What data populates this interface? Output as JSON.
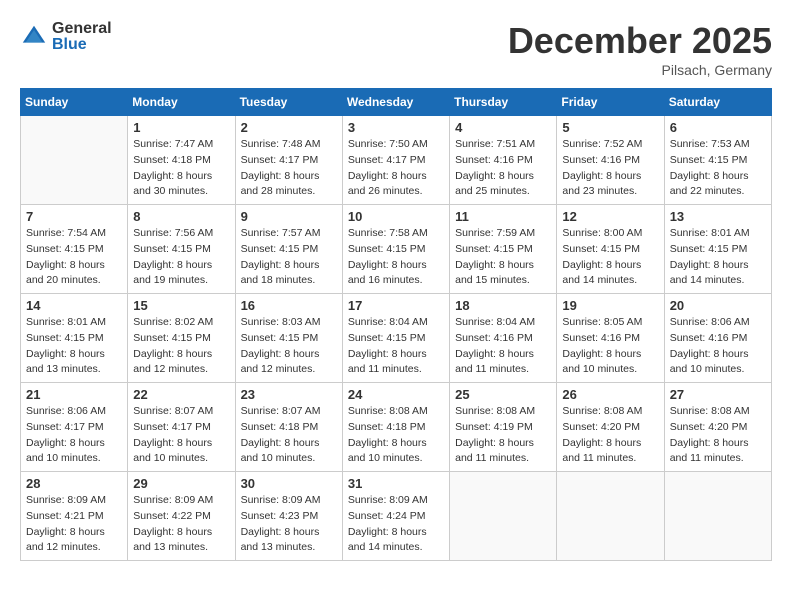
{
  "header": {
    "logo_line1": "General",
    "logo_line2": "Blue",
    "month": "December 2025",
    "location": "Pilsach, Germany"
  },
  "days_of_week": [
    "Sunday",
    "Monday",
    "Tuesday",
    "Wednesday",
    "Thursday",
    "Friday",
    "Saturday"
  ],
  "weeks": [
    [
      {
        "num": "",
        "sunrise": "",
        "sunset": "",
        "daylight": ""
      },
      {
        "num": "1",
        "sunrise": "Sunrise: 7:47 AM",
        "sunset": "Sunset: 4:18 PM",
        "daylight": "Daylight: 8 hours and 30 minutes."
      },
      {
        "num": "2",
        "sunrise": "Sunrise: 7:48 AM",
        "sunset": "Sunset: 4:17 PM",
        "daylight": "Daylight: 8 hours and 28 minutes."
      },
      {
        "num": "3",
        "sunrise": "Sunrise: 7:50 AM",
        "sunset": "Sunset: 4:17 PM",
        "daylight": "Daylight: 8 hours and 26 minutes."
      },
      {
        "num": "4",
        "sunrise": "Sunrise: 7:51 AM",
        "sunset": "Sunset: 4:16 PM",
        "daylight": "Daylight: 8 hours and 25 minutes."
      },
      {
        "num": "5",
        "sunrise": "Sunrise: 7:52 AM",
        "sunset": "Sunset: 4:16 PM",
        "daylight": "Daylight: 8 hours and 23 minutes."
      },
      {
        "num": "6",
        "sunrise": "Sunrise: 7:53 AM",
        "sunset": "Sunset: 4:15 PM",
        "daylight": "Daylight: 8 hours and 22 minutes."
      }
    ],
    [
      {
        "num": "7",
        "sunrise": "Sunrise: 7:54 AM",
        "sunset": "Sunset: 4:15 PM",
        "daylight": "Daylight: 8 hours and 20 minutes."
      },
      {
        "num": "8",
        "sunrise": "Sunrise: 7:56 AM",
        "sunset": "Sunset: 4:15 PM",
        "daylight": "Daylight: 8 hours and 19 minutes."
      },
      {
        "num": "9",
        "sunrise": "Sunrise: 7:57 AM",
        "sunset": "Sunset: 4:15 PM",
        "daylight": "Daylight: 8 hours and 18 minutes."
      },
      {
        "num": "10",
        "sunrise": "Sunrise: 7:58 AM",
        "sunset": "Sunset: 4:15 PM",
        "daylight": "Daylight: 8 hours and 16 minutes."
      },
      {
        "num": "11",
        "sunrise": "Sunrise: 7:59 AM",
        "sunset": "Sunset: 4:15 PM",
        "daylight": "Daylight: 8 hours and 15 minutes."
      },
      {
        "num": "12",
        "sunrise": "Sunrise: 8:00 AM",
        "sunset": "Sunset: 4:15 PM",
        "daylight": "Daylight: 8 hours and 14 minutes."
      },
      {
        "num": "13",
        "sunrise": "Sunrise: 8:01 AM",
        "sunset": "Sunset: 4:15 PM",
        "daylight": "Daylight: 8 hours and 14 minutes."
      }
    ],
    [
      {
        "num": "14",
        "sunrise": "Sunrise: 8:01 AM",
        "sunset": "Sunset: 4:15 PM",
        "daylight": "Daylight: 8 hours and 13 minutes."
      },
      {
        "num": "15",
        "sunrise": "Sunrise: 8:02 AM",
        "sunset": "Sunset: 4:15 PM",
        "daylight": "Daylight: 8 hours and 12 minutes."
      },
      {
        "num": "16",
        "sunrise": "Sunrise: 8:03 AM",
        "sunset": "Sunset: 4:15 PM",
        "daylight": "Daylight: 8 hours and 12 minutes."
      },
      {
        "num": "17",
        "sunrise": "Sunrise: 8:04 AM",
        "sunset": "Sunset: 4:15 PM",
        "daylight": "Daylight: 8 hours and 11 minutes."
      },
      {
        "num": "18",
        "sunrise": "Sunrise: 8:04 AM",
        "sunset": "Sunset: 4:16 PM",
        "daylight": "Daylight: 8 hours and 11 minutes."
      },
      {
        "num": "19",
        "sunrise": "Sunrise: 8:05 AM",
        "sunset": "Sunset: 4:16 PM",
        "daylight": "Daylight: 8 hours and 10 minutes."
      },
      {
        "num": "20",
        "sunrise": "Sunrise: 8:06 AM",
        "sunset": "Sunset: 4:16 PM",
        "daylight": "Daylight: 8 hours and 10 minutes."
      }
    ],
    [
      {
        "num": "21",
        "sunrise": "Sunrise: 8:06 AM",
        "sunset": "Sunset: 4:17 PM",
        "daylight": "Daylight: 8 hours and 10 minutes."
      },
      {
        "num": "22",
        "sunrise": "Sunrise: 8:07 AM",
        "sunset": "Sunset: 4:17 PM",
        "daylight": "Daylight: 8 hours and 10 minutes."
      },
      {
        "num": "23",
        "sunrise": "Sunrise: 8:07 AM",
        "sunset": "Sunset: 4:18 PM",
        "daylight": "Daylight: 8 hours and 10 minutes."
      },
      {
        "num": "24",
        "sunrise": "Sunrise: 8:08 AM",
        "sunset": "Sunset: 4:18 PM",
        "daylight": "Daylight: 8 hours and 10 minutes."
      },
      {
        "num": "25",
        "sunrise": "Sunrise: 8:08 AM",
        "sunset": "Sunset: 4:19 PM",
        "daylight": "Daylight: 8 hours and 11 minutes."
      },
      {
        "num": "26",
        "sunrise": "Sunrise: 8:08 AM",
        "sunset": "Sunset: 4:20 PM",
        "daylight": "Daylight: 8 hours and 11 minutes."
      },
      {
        "num": "27",
        "sunrise": "Sunrise: 8:08 AM",
        "sunset": "Sunset: 4:20 PM",
        "daylight": "Daylight: 8 hours and 11 minutes."
      }
    ],
    [
      {
        "num": "28",
        "sunrise": "Sunrise: 8:09 AM",
        "sunset": "Sunset: 4:21 PM",
        "daylight": "Daylight: 8 hours and 12 minutes."
      },
      {
        "num": "29",
        "sunrise": "Sunrise: 8:09 AM",
        "sunset": "Sunset: 4:22 PM",
        "daylight": "Daylight: 8 hours and 13 minutes."
      },
      {
        "num": "30",
        "sunrise": "Sunrise: 8:09 AM",
        "sunset": "Sunset: 4:23 PM",
        "daylight": "Daylight: 8 hours and 13 minutes."
      },
      {
        "num": "31",
        "sunrise": "Sunrise: 8:09 AM",
        "sunset": "Sunset: 4:24 PM",
        "daylight": "Daylight: 8 hours and 14 minutes."
      },
      {
        "num": "",
        "sunrise": "",
        "sunset": "",
        "daylight": ""
      },
      {
        "num": "",
        "sunrise": "",
        "sunset": "",
        "daylight": ""
      },
      {
        "num": "",
        "sunrise": "",
        "sunset": "",
        "daylight": ""
      }
    ]
  ]
}
